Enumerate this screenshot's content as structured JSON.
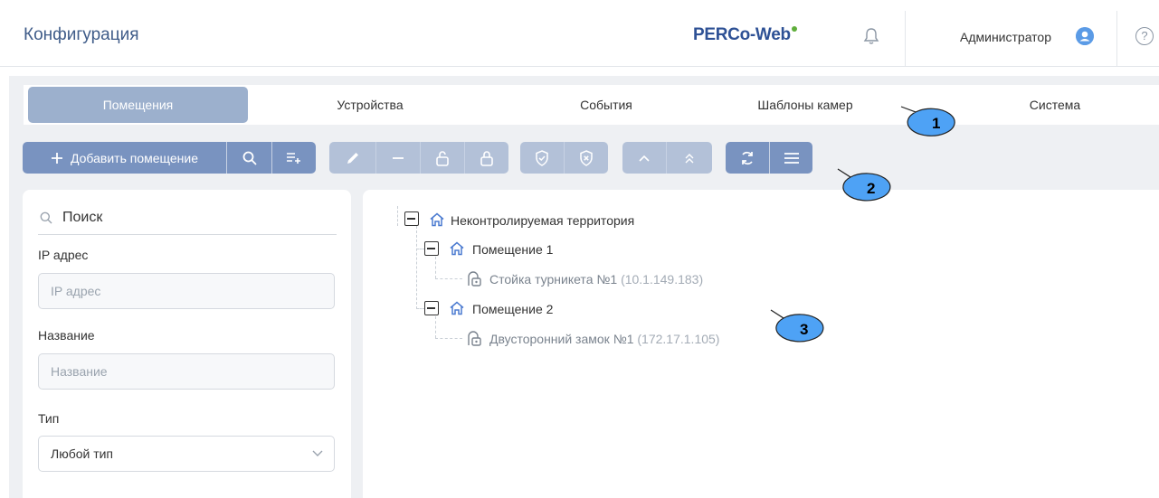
{
  "header": {
    "title": "Конфигурация",
    "logo": "PERCo-Web",
    "user": "Администратор",
    "help": "?"
  },
  "tabs": [
    {
      "label": "Помещения",
      "active": true
    },
    {
      "label": "Устройства",
      "active": false
    },
    {
      "label": "События",
      "active": false
    },
    {
      "label": "Шаблоны камер",
      "active": false
    },
    {
      "label": "Система",
      "active": false
    }
  ],
  "toolbar": {
    "add_room": "Добавить помещение",
    "icons": [
      "plus-icon",
      "search-icon",
      "add-list-icon",
      "edit-icon",
      "minus-icon",
      "unlock-icon",
      "lock-icon",
      "shield-check-icon",
      "shield-x-icon",
      "chevron-up-icon",
      "double-chevron-up-icon",
      "refresh-icon",
      "menu-icon"
    ]
  },
  "filters": {
    "search_placeholder": "Поиск",
    "ip_label": "IP адрес",
    "ip_placeholder": "IP адрес",
    "name_label": "Название",
    "name_placeholder": "Название",
    "type_label": "Тип",
    "type_value": "Любой тип"
  },
  "tree": {
    "root": "Неконтролируемая территория",
    "room1": "Помещение 1",
    "device1": "Стойка турникета №1",
    "device1_ip": "(10.1.149.183)",
    "room2": "Помещение 2",
    "device2": "Двусторонний замок №1",
    "device2_ip": "(172.17.1.105)"
  },
  "callouts": [
    "1",
    "2",
    "3"
  ],
  "colors": {
    "primary": "#7993c0",
    "primary_disabled": "#b3c1d8",
    "tab_active": "#9cb0cd",
    "title": "#3f5c89",
    "logo": "#2e5195",
    "logo_dot": "#5fae3b",
    "callout_fill": "#4ea2f5"
  }
}
